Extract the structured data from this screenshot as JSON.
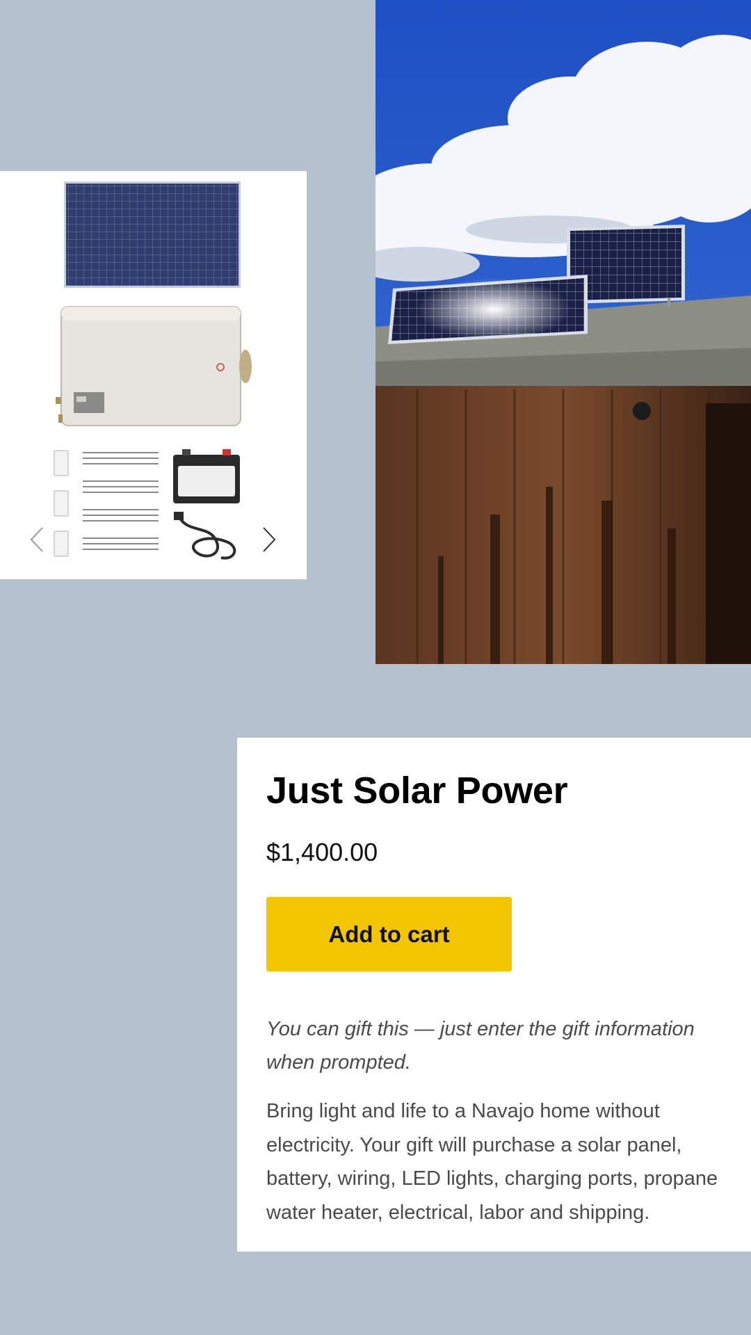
{
  "gallery": {
    "prev_icon": "chevron-left-icon",
    "next_icon": "chevron-right-icon",
    "items": [
      "solar panel",
      "propane water heater",
      "light switches",
      "LED light strips",
      "battery",
      "charging cable"
    ]
  },
  "photo": {
    "subject": "solar panels on roof"
  },
  "product": {
    "title": "Just Solar Power",
    "price": "$1,400.00",
    "add_to_cart_label": "Add to cart",
    "gift_note": "You can gift this — just enter the gift information when prompted.",
    "description": "Bring light and life to a Navajo home without electricity. Your gift will purchase a solar panel, battery, wiring, LED lights, charging ports, propane water heater, electrical, labor and shipping."
  },
  "colors": {
    "background": "#b3c2ce",
    "button": "#f2c500",
    "card": "#ffffff"
  }
}
